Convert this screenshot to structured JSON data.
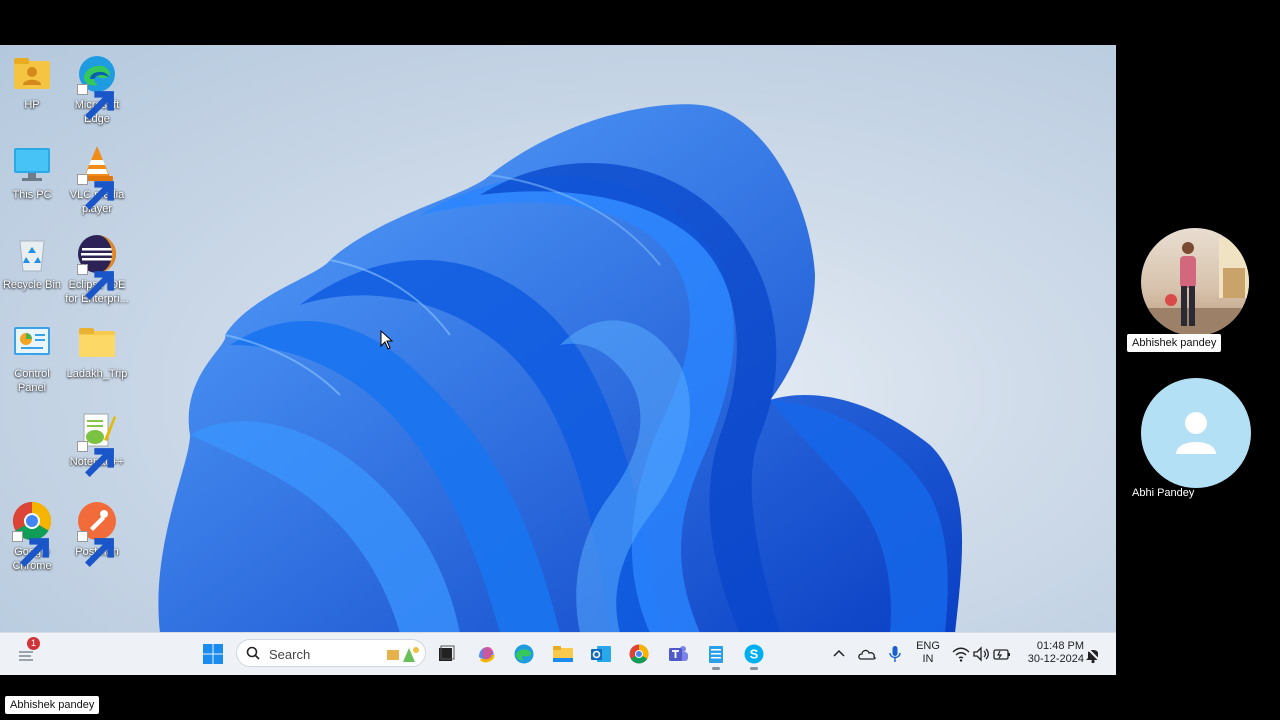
{
  "desktop": {
    "icons": [
      {
        "label": "HP",
        "icon": "user-folder-icon"
      },
      {
        "label": "Microsoft Edge",
        "icon": "edge-icon"
      },
      {
        "label": "This PC",
        "icon": "monitor-icon"
      },
      {
        "label": "VLC media player",
        "icon": "vlc-icon"
      },
      {
        "label": "Recycle Bin",
        "icon": "recycle-bin-icon"
      },
      {
        "label": "Eclipse IDE for Enterpri...",
        "icon": "eclipse-icon"
      },
      {
        "label": "Control Panel",
        "icon": "control-panel-icon"
      },
      {
        "label": "Ladakh_Trip",
        "icon": "folder-icon"
      },
      {
        "label": "Notepad++",
        "icon": "notepad-plus-icon"
      },
      {
        "label": "Google Chrome",
        "icon": "chrome-icon"
      },
      {
        "label": "Postman",
        "icon": "postman-icon"
      }
    ]
  },
  "taskbar": {
    "widgets_badge": "1",
    "search_placeholder": "Search",
    "apps": [
      "start-icon",
      "task-view-icon",
      "copilot-icon",
      "edge-icon",
      "file-explorer-icon",
      "outlook-icon",
      "chrome-icon",
      "teams-icon",
      "notepad-icon",
      "skype-icon"
    ],
    "language_top": "ENG",
    "language_bottom": "IN",
    "time": "01:48 PM",
    "date": "30-12-2024"
  },
  "participants": [
    {
      "name": "Abhishek pandey",
      "avatar": "photo-avatar"
    },
    {
      "name": "Abhi Pandey",
      "avatar": "default-avatar"
    }
  ],
  "presenter_label": "Abhishek pandey",
  "colors": {
    "wallpaper_blue": "#1565e6",
    "taskbar_bg": "#eef2f7",
    "frame_bg": "#000000",
    "avatar_bg": "#b3e0f5",
    "badge_red": "#d13438"
  }
}
